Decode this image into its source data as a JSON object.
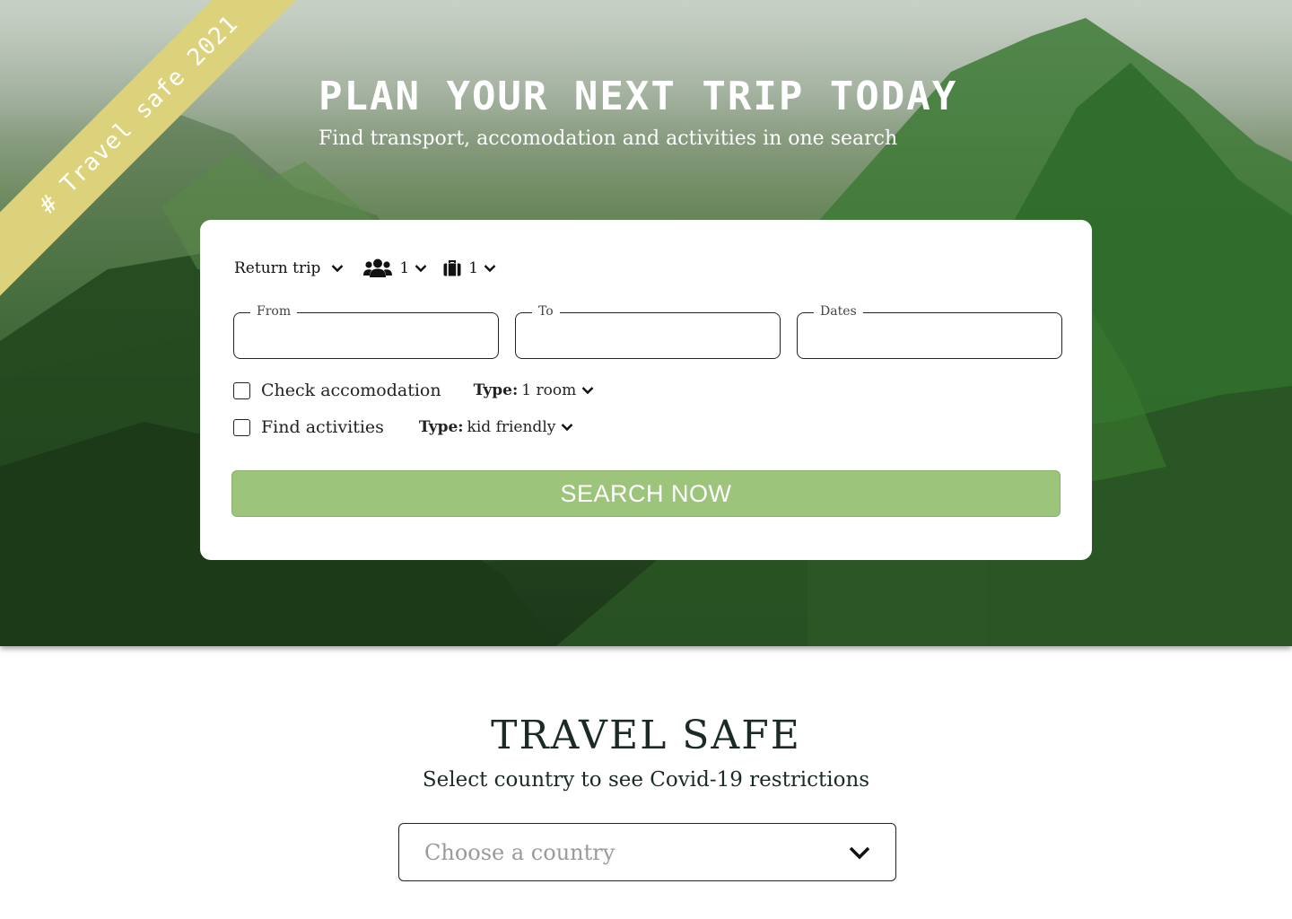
{
  "ribbon": {
    "text": "# Travel safe 2021"
  },
  "hero": {
    "title": "PLAN YOUR NEXT TRIP TODAY",
    "subtitle": "Find transport, accomodation and activities in one search"
  },
  "search": {
    "trip_type": "Return trip",
    "travellers": "1",
    "luggage": "1",
    "fields": {
      "from_label": "From",
      "to_label": "To",
      "dates_label": "Dates",
      "from_value": "",
      "to_value": "",
      "dates_value": ""
    },
    "accomodation": {
      "label": "Check accomodation",
      "checked": false,
      "type_label": "Type:",
      "type_value": "1 room"
    },
    "activities": {
      "label": "Find activities",
      "checked": false,
      "type_label": "Type:",
      "type_value": "kid friendly"
    },
    "button_label": "SEARCH NOW"
  },
  "travel_safe": {
    "title": "TRAVEL SAFE",
    "subtitle": "Select country to see Covid-19 restrictions",
    "select_placeholder": "Choose a country"
  },
  "icons": {
    "people": "users-icon",
    "luggage": "suitcase-icon",
    "dropdown": "chevron-down-icon"
  },
  "colors": {
    "ribbon": "#dcd27c",
    "button": "#9cc47b",
    "text_dark": "#1b2a26",
    "placeholder": "#9a9a9a"
  }
}
